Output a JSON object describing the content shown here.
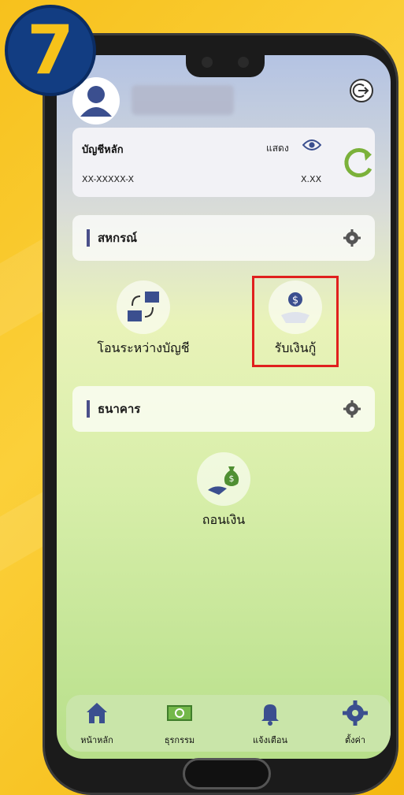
{
  "step_badge": "7",
  "account": {
    "title": "บัญชีหลัก",
    "show_label": "แสดง",
    "number": "XX-XXXXX-X",
    "balance": "X.XX"
  },
  "sections": {
    "cooperative": {
      "title": "สหกรณ์"
    },
    "bank": {
      "title": "ธนาคาร"
    }
  },
  "menu": {
    "transfer_label": "โอนระหว่างบัญชี",
    "receive_loan_label": "รับเงินกู้",
    "withdraw_label": "ถอนเงิน"
  },
  "bottom_nav": {
    "home": "หน้าหลัก",
    "transactions": "ธุรกรรม",
    "notifications": "แจ้งเตือน",
    "settings": "ตั้งค่า"
  },
  "colors": {
    "accent_navy": "#123d82",
    "badge_text": "#f6c21a",
    "refresh_green": "#7bb13a",
    "highlight_red": "#e0201e",
    "nav_icon": "#3b4f8f"
  }
}
